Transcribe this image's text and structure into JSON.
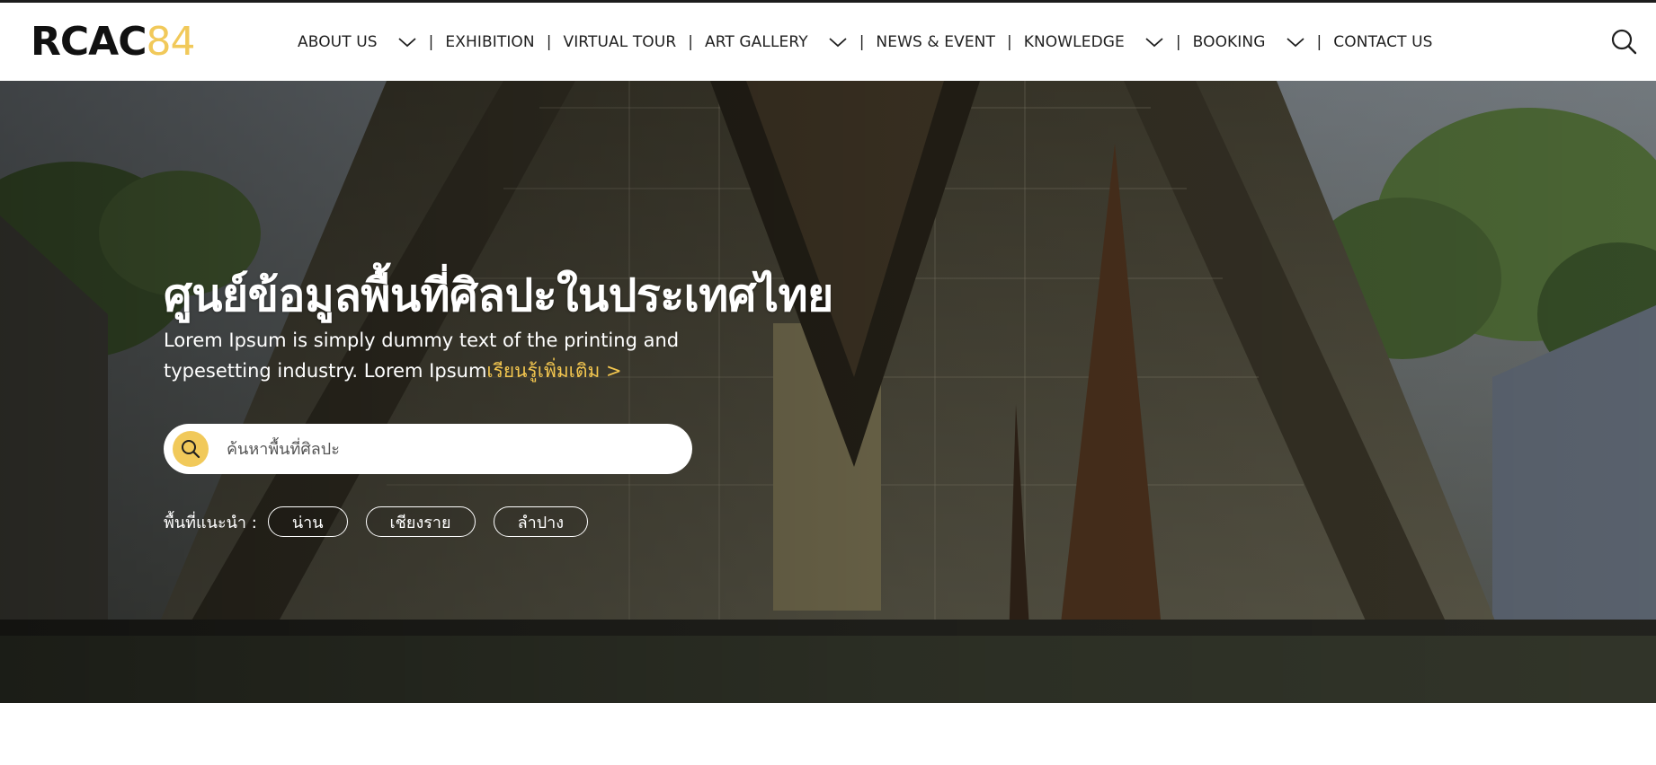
{
  "brand": {
    "logo_text": "RCAC",
    "logo_number": "84",
    "accent_color": "#f1c95a"
  },
  "nav": {
    "items": [
      {
        "label": "ABOUT US",
        "has_dropdown": true
      },
      {
        "label": "EXHIBITION",
        "has_dropdown": false
      },
      {
        "label": "VIRTUAL TOUR",
        "has_dropdown": false
      },
      {
        "label": "ART GALLERY",
        "has_dropdown": true
      },
      {
        "label": "NEWS & EVENT",
        "has_dropdown": false
      },
      {
        "label": "KNOWLEDGE",
        "has_dropdown": true
      },
      {
        "label": "BOOKING",
        "has_dropdown": true
      },
      {
        "label": "CONTACT US",
        "has_dropdown": false
      }
    ],
    "separator": "|",
    "search_icon": "search-icon",
    "dropdown_icon": "chevron-down-icon"
  },
  "hero": {
    "title": "ศูนย์ข้อมูลพื้นที่ศิลปะในประเทศไทย",
    "description": "Lorem Ipsum is simply dummy text of the printing and typesetting industry. Lorem Ipsum",
    "more_link": "เรียนรู้เพิ่มเติม >",
    "search": {
      "placeholder": "ค้นหาพื้นที่ศิลปะ",
      "value": "",
      "icon": "search-icon"
    },
    "suggest_label": "พื้นที่แนะนำ :",
    "suggestions": [
      "น่าน",
      "เชียงราย",
      "ลำปาง"
    ]
  }
}
